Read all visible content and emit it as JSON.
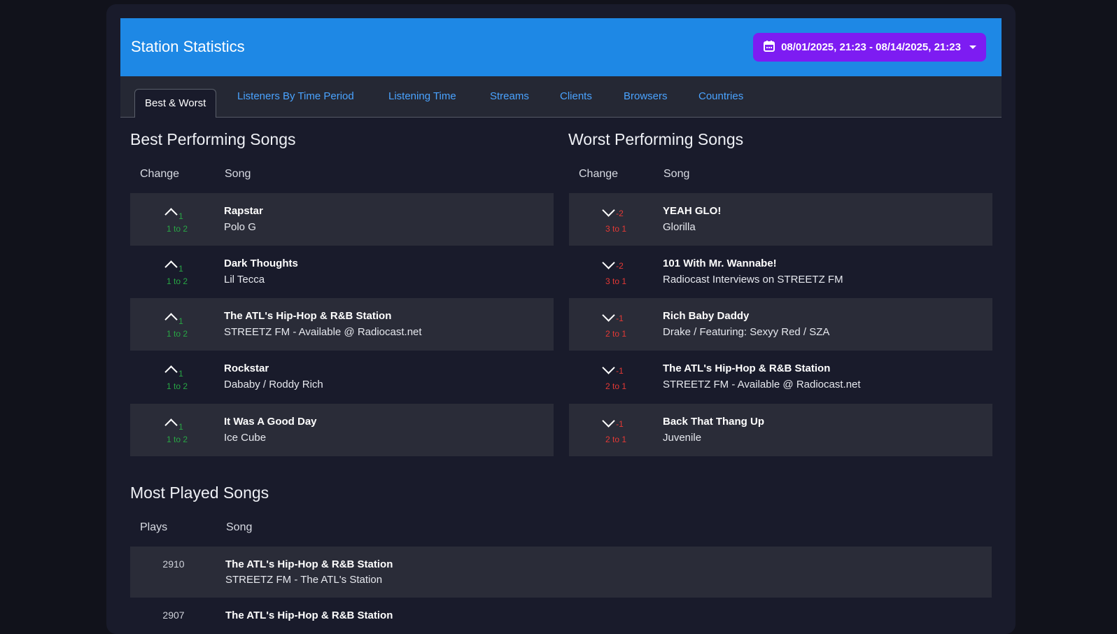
{
  "header": {
    "title": "Station Statistics",
    "date_range": "08/01/2025, 21:23 - 08/14/2025, 21:23"
  },
  "tabs": [
    "Best & Worst",
    "Listeners By Time Period",
    "Listening Time",
    "Streams",
    "Clients",
    "Browsers",
    "Countries"
  ],
  "best": {
    "title": "Best Performing Songs",
    "col_change": "Change",
    "col_song": "Song",
    "rows": [
      {
        "delta": "1",
        "range": "1 to 2",
        "title": "Rapstar",
        "artist": "Polo G"
      },
      {
        "delta": "1",
        "range": "1 to 2",
        "title": "Dark Thoughts",
        "artist": "Lil Tecca"
      },
      {
        "delta": "1",
        "range": "1 to 2",
        "title": "The ATL's Hip-Hop & R&B Station",
        "artist": "STREETZ FM - Available @ Radiocast.net"
      },
      {
        "delta": "1",
        "range": "1 to 2",
        "title": "Rockstar",
        "artist": "Dababy / Roddy Rich"
      },
      {
        "delta": "1",
        "range": "1 to 2",
        "title": "It Was A Good Day",
        "artist": "Ice Cube"
      }
    ]
  },
  "worst": {
    "title": "Worst Performing Songs",
    "col_change": "Change",
    "col_song": "Song",
    "rows": [
      {
        "delta": "-2",
        "range": "3 to 1",
        "title": "YEAH GLO!",
        "artist": "Glorilla"
      },
      {
        "delta": "-2",
        "range": "3 to 1",
        "title": "101 With Mr. Wannabe!",
        "artist": "Radiocast Interviews on STREETZ FM"
      },
      {
        "delta": "-1",
        "range": "2 to 1",
        "title": "Rich Baby Daddy",
        "artist": "Drake / Featuring: Sexyy Red / SZA"
      },
      {
        "delta": "-1",
        "range": "2 to 1",
        "title": "The ATL's Hip-Hop & R&B Station",
        "artist": "STREETZ FM - Available @ Radiocast.net"
      },
      {
        "delta": "-1",
        "range": "2 to 1",
        "title": "Back That Thang Up",
        "artist": "Juvenile"
      }
    ]
  },
  "most_played": {
    "title": "Most Played Songs",
    "col_plays": "Plays",
    "col_song": "Song",
    "rows": [
      {
        "plays": "2910",
        "title": "The ATL's Hip-Hop & R&B Station",
        "artist": "STREETZ FM - The ATL's Station"
      },
      {
        "plays": "2907",
        "title": "The ATL's Hip-Hop & R&B Station",
        "artist": ""
      }
    ]
  },
  "colors": {
    "header": "#1e88e5",
    "date_button": "#7d1cf2",
    "up": "#28a745",
    "down": "#e53935",
    "tab_link": "#4aa3ff"
  }
}
